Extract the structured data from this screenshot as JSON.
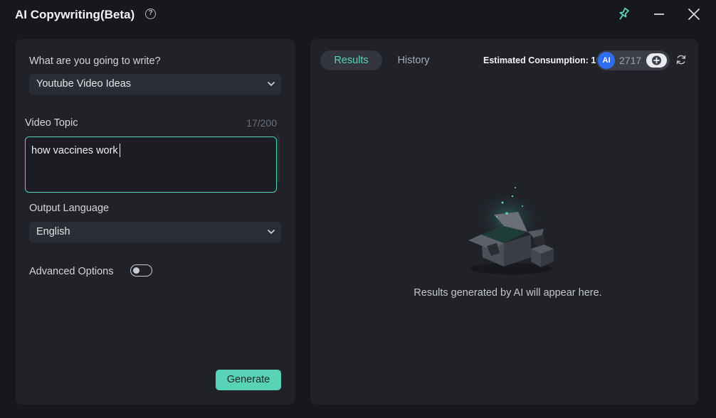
{
  "window": {
    "title": "AI Copywriting(Beta)",
    "help_icon": "?"
  },
  "left": {
    "write_label": "What are you going to write?",
    "write_type": "Youtube Video Ideas",
    "topic_label": "Video Topic",
    "topic_counter": "17/200",
    "topic_value": "how vaccines work",
    "language_label": "Output Language",
    "language_value": "English",
    "advanced_label": "Advanced Options",
    "advanced_enabled": false,
    "generate_label": "Generate"
  },
  "right": {
    "tabs": [
      {
        "label": "Results",
        "active": true
      },
      {
        "label": "History",
        "active": false
      }
    ],
    "estimated_consumption": "Estimated Consumption: 10",
    "ai_badge": "AI",
    "credits": "2717",
    "empty_message": "Results generated by AI will appear here."
  },
  "icons": [
    "help-icon",
    "pin-icon",
    "minimize-icon",
    "close-icon",
    "chevron-down-icon",
    "plus-icon",
    "refresh-icon",
    "empty-box-illustration"
  ],
  "colors": {
    "accent": "#58d3b8",
    "panel": "#202228",
    "background": "#16181d",
    "ai_badge": "#2f6ef0"
  }
}
